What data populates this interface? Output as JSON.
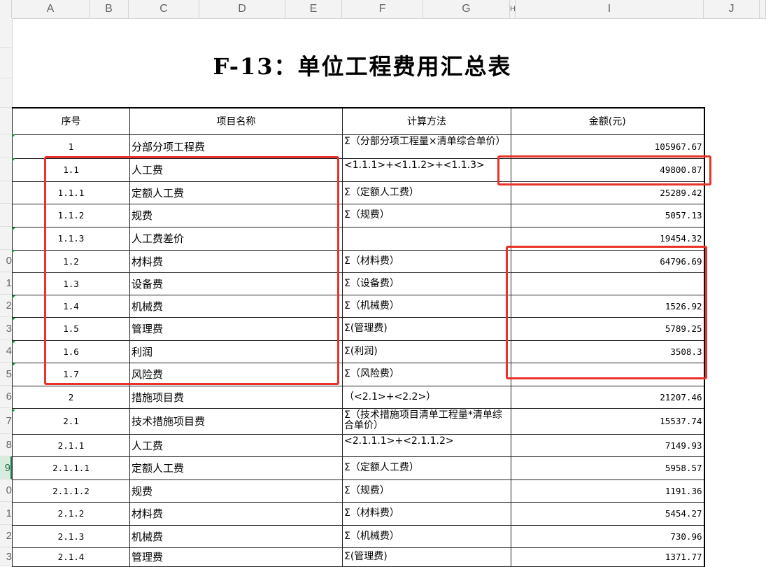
{
  "columns": [
    "A",
    "B",
    "C",
    "D",
    "E",
    "F",
    "G",
    "H",
    "I",
    "J"
  ],
  "row_numbers": [
    "0",
    "1",
    "2",
    "3",
    "4",
    "5",
    "6",
    "7",
    "8",
    "9",
    "0",
    "1",
    "2",
    "3"
  ],
  "title": "F-13：单位工程费用汇总表",
  "table": {
    "headers": [
      "序号",
      "项目名称",
      "计算方法",
      "金额(元)"
    ],
    "rows": [
      {
        "no": "1",
        "name": "分部分项工程费",
        "method": "Σ（分部分项工程量×清单综合单价）",
        "amount": "105967.67"
      },
      {
        "no": "1.1",
        "name": "人工费",
        "method": "<1.1.1>+<1.1.2>+<1.1.3>",
        "amount": "49800.87"
      },
      {
        "no": "1.1.1",
        "name": "定额人工费",
        "method": "Σ（定额人工费）",
        "amount": "25289.42"
      },
      {
        "no": "1.1.2",
        "name": "规费",
        "method": "Σ（规费）",
        "amount": "5057.13"
      },
      {
        "no": "1.1.3",
        "name": "人工费差价",
        "method": "",
        "amount": "19454.32"
      },
      {
        "no": "1.2",
        "name": "材料费",
        "method": "Σ（材料费）",
        "amount": "64796.69"
      },
      {
        "no": "1.3",
        "name": "设备费",
        "method": "Σ（设备费）",
        "amount": ""
      },
      {
        "no": "1.4",
        "name": "机械费",
        "method": "Σ（机械费）",
        "amount": "1526.92"
      },
      {
        "no": "1.5",
        "name": "管理费",
        "method": "Σ(管理费)",
        "amount": "5789.25"
      },
      {
        "no": "1.6",
        "name": "利润",
        "method": "Σ(利润)",
        "amount": "3508.3"
      },
      {
        "no": "1.7",
        "name": "风险费",
        "method": "Σ（风险费）",
        "amount": ""
      },
      {
        "no": "2",
        "name": "措施项目费",
        "method": "（<2.1>+<2.2>）",
        "amount": "21207.46"
      },
      {
        "no": "2.1",
        "name": "技术措施项目费",
        "method": "Σ（技术措施项目清单工程量*清单综合单价）",
        "amount": "15537.74"
      },
      {
        "no": "2.1.1",
        "name": "人工费",
        "method": "<2.1.1.1>+<2.1.1.2>",
        "amount": "7149.93"
      },
      {
        "no": "2.1.1.1",
        "name": "定额人工费",
        "method": "Σ（定额人工费）",
        "amount": "5958.57"
      },
      {
        "no": "2.1.1.2",
        "name": "规费",
        "method": "Σ（规费）",
        "amount": "1191.36"
      },
      {
        "no": "2.1.2",
        "name": "材料费",
        "method": "Σ（材料费）",
        "amount": "5454.27"
      },
      {
        "no": "2.1.3",
        "name": "机械费",
        "method": "Σ（机械费）",
        "amount": "730.96"
      },
      {
        "no": "2.1.4",
        "name": "管理费",
        "method": "Σ(管理费)",
        "amount": "1371.77"
      }
    ]
  },
  "colors": {
    "highlight": "#e8332a",
    "selected_row_header": "#217346",
    "error_triangle": "#1a8a3a"
  }
}
